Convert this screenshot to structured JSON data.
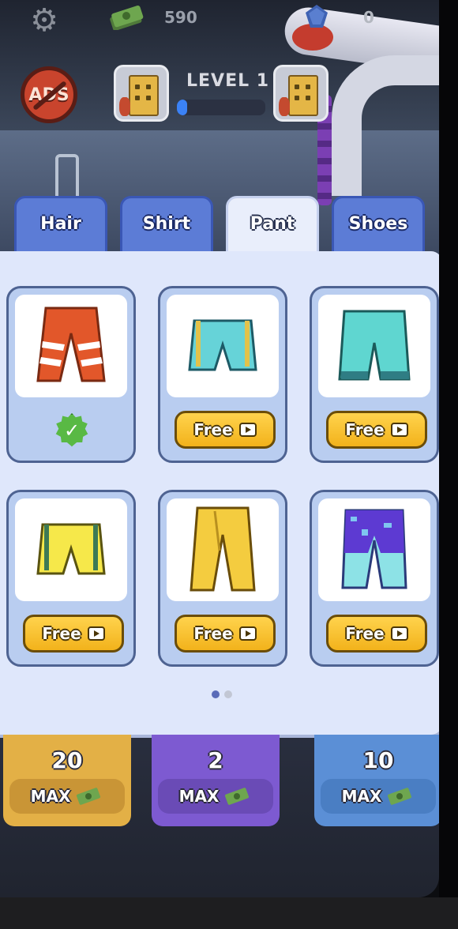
{
  "hud": {
    "cash_value": "590",
    "gem_value": "0",
    "ads_label": "ADS",
    "level_title": "LEVEL 1",
    "level_progress": 0.12
  },
  "tabs": [
    {
      "label": "Hair",
      "active": false
    },
    {
      "label": "Shirt",
      "active": false
    },
    {
      "label": "Pant",
      "active": true
    },
    {
      "label": "Shoes",
      "active": false
    }
  ],
  "items": [
    {
      "name": "red-white-striped-pants",
      "colors": [
        "#e2572a",
        "#ffffff"
      ],
      "state": "selected"
    },
    {
      "name": "cyan-short-shorts",
      "colors": [
        "#66d3d8"
      ],
      "state": "free",
      "button_label": "Free"
    },
    {
      "name": "cyan-long-shorts",
      "colors": [
        "#5fd6d0"
      ],
      "state": "free",
      "button_label": "Free"
    },
    {
      "name": "yellow-short-shorts",
      "colors": [
        "#f6e84a"
      ],
      "state": "free",
      "button_label": "Free"
    },
    {
      "name": "yellow-long-pants",
      "colors": [
        "#f4cc3f"
      ],
      "state": "free",
      "button_label": "Free"
    },
    {
      "name": "purple-cyan-pants",
      "colors": [
        "#5d3ad2",
        "#8de2e6"
      ],
      "state": "free",
      "button_label": "Free"
    }
  ],
  "pagination": {
    "pages": 2,
    "current": 1
  },
  "upgrades": [
    {
      "value": "20",
      "label": "MAX",
      "color": "#e3b046"
    },
    {
      "value": "2",
      "label": "MAX",
      "color": "#7d5ad1"
    },
    {
      "value": "10",
      "label": "MAX",
      "color": "#5b8fd6"
    }
  ],
  "colors": {
    "accent_blue": "#5c7cd6",
    "button_yellow": "#f2b21b",
    "panel": "#dfe7fb"
  }
}
